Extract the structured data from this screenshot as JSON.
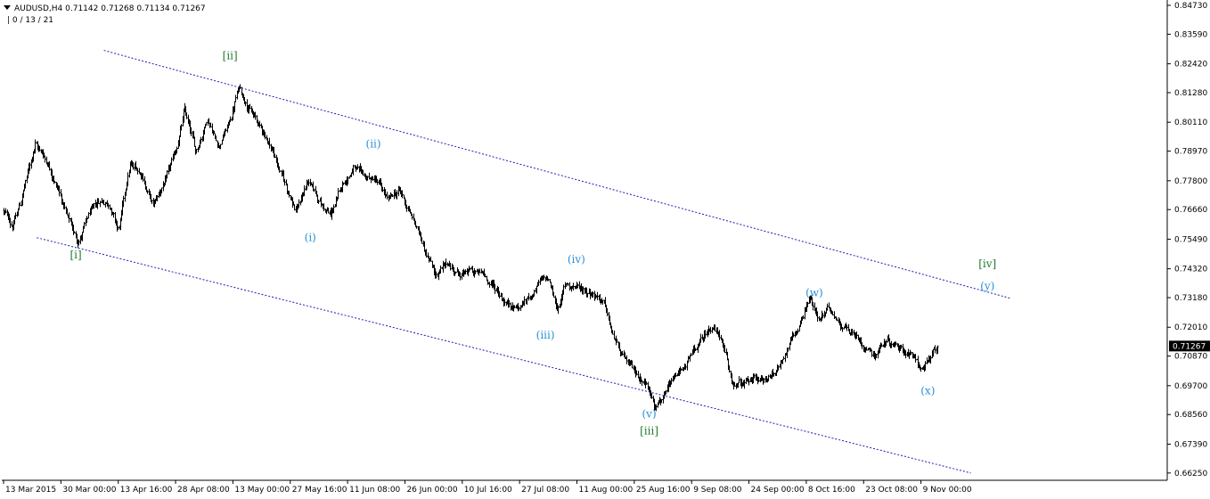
{
  "header": {
    "symbol": "AUDUSD,H4",
    "open": "0.71142",
    "high": "0.71268",
    "low": "0.71134",
    "close": "0.71267",
    "indicator_line": "| 0 / 13 / 21"
  },
  "colors": {
    "background": "#ffffff",
    "price": "#000000",
    "axis": "#000000",
    "channel": "#1d1db8",
    "wave_primary": "#1d7a2a",
    "wave_minor": "#2a90d8",
    "price_tag": "#000000",
    "price_tag_text": "#ffffff"
  },
  "chart_data": {
    "type": "bar",
    "subtype": "ohlc",
    "symbol": "AUDUSD",
    "timeframe": "H4",
    "y_ticks": [
      "0.84730",
      "0.83590",
      "0.82420",
      "0.81280",
      "0.80110",
      "0.78970",
      "0.77800",
      "0.76660",
      "0.75490",
      "0.74320",
      "0.73180",
      "0.72010",
      "0.70870",
      "0.69700",
      "0.68560",
      "0.67390",
      "0.66250"
    ],
    "ylim": [
      0.6615,
      0.848
    ],
    "x_ticks": [
      "13 Mar 2015",
      "30 Mar 00:00",
      "13 Apr 16:00",
      "28 Apr 08:00",
      "13 May 00:00",
      "27 May 16:00",
      "11 Jun 08:00",
      "26 Jun 00:00",
      "10 Jul 16:00",
      "27 Jul 08:00",
      "11 Aug 00:00",
      "25 Aug 16:00",
      "9 Sep 08:00",
      "24 Sep 00:00",
      "8 Oct 16:00",
      "23 Oct 08:00",
      "9 Nov 00:00"
    ],
    "x_tick_pos": [
      0,
      1,
      2,
      3,
      4,
      5,
      6,
      7,
      8,
      9,
      10,
      11,
      12,
      13,
      14,
      15,
      16
    ],
    "current_price": "0.71267",
    "price_path": [
      [
        0.0,
        0.766
      ],
      [
        0.15,
        0.76
      ],
      [
        0.3,
        0.77
      ],
      [
        0.55,
        0.793
      ],
      [
        0.75,
        0.786
      ],
      [
        0.95,
        0.775
      ],
      [
        1.1,
        0.764
      ],
      [
        1.3,
        0.754
      ],
      [
        1.5,
        0.765
      ],
      [
        1.7,
        0.77
      ],
      [
        1.85,
        0.769
      ],
      [
        2.0,
        0.758
      ],
      [
        2.2,
        0.784
      ],
      [
        2.4,
        0.781
      ],
      [
        2.6,
        0.768
      ],
      [
        2.8,
        0.777
      ],
      [
        3.0,
        0.789
      ],
      [
        3.15,
        0.806
      ],
      [
        3.35,
        0.789
      ],
      [
        3.55,
        0.803
      ],
      [
        3.75,
        0.792
      ],
      [
        3.95,
        0.802
      ],
      [
        4.1,
        0.815
      ],
      [
        4.3,
        0.806
      ],
      [
        4.5,
        0.798
      ],
      [
        4.65,
        0.792
      ],
      [
        4.85,
        0.78
      ],
      [
        5.1,
        0.766
      ],
      [
        5.3,
        0.778
      ],
      [
        5.5,
        0.77
      ],
      [
        5.7,
        0.764
      ],
      [
        5.9,
        0.776
      ],
      [
        6.1,
        0.783
      ],
      [
        6.3,
        0.779
      ],
      [
        6.5,
        0.778
      ],
      [
        6.7,
        0.77
      ],
      [
        6.9,
        0.774
      ],
      [
        7.15,
        0.762
      ],
      [
        7.35,
        0.751
      ],
      [
        7.55,
        0.741
      ],
      [
        7.75,
        0.745
      ],
      [
        7.95,
        0.741
      ],
      [
        8.15,
        0.742
      ],
      [
        8.35,
        0.741
      ],
      [
        8.55,
        0.736
      ],
      [
        8.75,
        0.73
      ],
      [
        9.0,
        0.728
      ],
      [
        9.2,
        0.733
      ],
      [
        9.35,
        0.738
      ],
      [
        9.5,
        0.739
      ],
      [
        9.65,
        0.727
      ],
      [
        9.8,
        0.737
      ],
      [
        10.0,
        0.736
      ],
      [
        10.25,
        0.734
      ],
      [
        10.45,
        0.731
      ],
      [
        10.6,
        0.718
      ],
      [
        10.8,
        0.708
      ],
      [
        11.0,
        0.702
      ],
      [
        11.2,
        0.698
      ],
      [
        11.35,
        0.69
      ],
      [
        11.55,
        0.694
      ],
      [
        11.75,
        0.701
      ],
      [
        11.95,
        0.707
      ],
      [
        12.15,
        0.714
      ],
      [
        12.35,
        0.721
      ],
      [
        12.5,
        0.716
      ],
      [
        12.7,
        0.698
      ],
      [
        12.9,
        0.697
      ],
      [
        13.1,
        0.7
      ],
      [
        13.3,
        0.699
      ],
      [
        13.5,
        0.704
      ],
      [
        13.7,
        0.714
      ],
      [
        13.85,
        0.719
      ],
      [
        14.05,
        0.733
      ],
      [
        14.2,
        0.723
      ],
      [
        14.4,
        0.727
      ],
      [
        14.6,
        0.722
      ],
      [
        14.8,
        0.718
      ],
      [
        15.0,
        0.713
      ],
      [
        15.2,
        0.71
      ],
      [
        15.4,
        0.715
      ],
      [
        15.6,
        0.713
      ],
      [
        15.8,
        0.71
      ],
      [
        16.0,
        0.704
      ],
      [
        16.15,
        0.707
      ],
      [
        16.3,
        0.713
      ]
    ],
    "channel_lines": [
      {
        "name": "upper",
        "from": [
          1.75,
          0.8295
        ],
        "to": [
          17.55,
          0.7316
        ]
      },
      {
        "name": "lower",
        "from": [
          0.58,
          0.7555
        ],
        "to": [
          16.87,
          0.6625
        ]
      }
    ],
    "annotations": [
      {
        "label": "[i]",
        "degree": "primary",
        "x": 1.26,
        "y": 0.7487
      },
      {
        "label": "[ii]",
        "degree": "primary",
        "x": 3.95,
        "y": 0.8274
      },
      {
        "label": "[iii]",
        "degree": "primary",
        "x": 11.26,
        "y": 0.6791
      },
      {
        "label": "[iv]",
        "degree": "primary",
        "x": 17.16,
        "y": 0.7452
      },
      {
        "label": "(i)",
        "degree": "minor",
        "x": 5.35,
        "y": 0.7556
      },
      {
        "label": "(ii)",
        "degree": "minor",
        "x": 6.45,
        "y": 0.7925
      },
      {
        "label": "(iii)",
        "degree": "minor",
        "x": 9.45,
        "y": 0.717
      },
      {
        "label": "(iv)",
        "degree": "minor",
        "x": 9.99,
        "y": 0.7469
      },
      {
        "label": "(v)",
        "degree": "minor",
        "x": 11.26,
        "y": 0.6859
      },
      {
        "label": "(w)",
        "degree": "minor",
        "x": 14.14,
        "y": 0.7338
      },
      {
        "label": "(x)",
        "degree": "minor",
        "x": 16.12,
        "y": 0.695
      },
      {
        "label": "(y)",
        "degree": "minor",
        "x": 17.16,
        "y": 0.7363
      }
    ],
    "grid": false,
    "legend": "none"
  }
}
